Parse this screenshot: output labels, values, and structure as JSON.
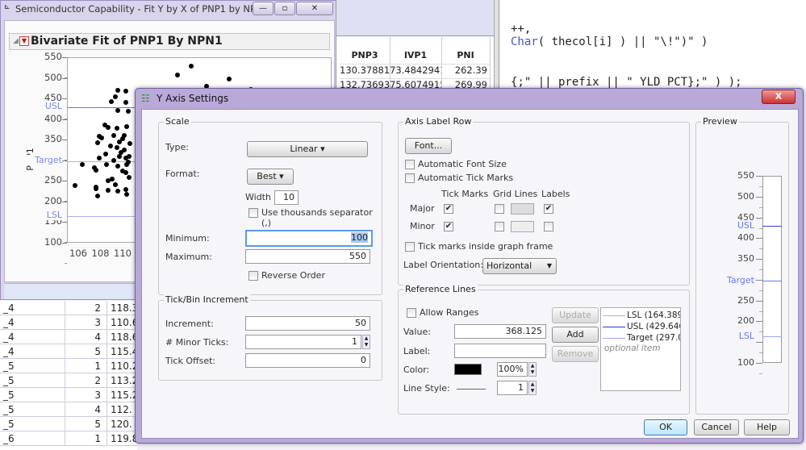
{
  "bg_window": {
    "title": "Semiconductor Capability - Fit Y by X of PNP1 by NP...",
    "outline_title": "Bivariate Fit of PNP1 By NPN1",
    "y_label": "PNP1",
    "y_ticks": [
      "550",
      "500",
      "450",
      "400",
      "350",
      "300",
      "250",
      "200",
      "150",
      "100"
    ],
    "x_ticks": [
      "106",
      "108",
      "110"
    ],
    "ref_lines": [
      {
        "label": "USL",
        "value": 429.646
      },
      {
        "label": "Target",
        "value": 297
      },
      {
        "label": "LSL",
        "value": 164.389
      }
    ],
    "points": [
      [
        116.1,
        529
      ],
      [
        114.9,
        507
      ],
      [
        119.5,
        497
      ],
      [
        117.5,
        480
      ],
      [
        121.5,
        471
      ],
      [
        109.5,
        470
      ],
      [
        110.2,
        468
      ],
      [
        112.8,
        470
      ],
      [
        117,
        470
      ],
      [
        114.5,
        455
      ],
      [
        109.3,
        455
      ],
      [
        108.9,
        443
      ],
      [
        110.2,
        440
      ],
      [
        113,
        435
      ],
      [
        109.5,
        420
      ],
      [
        110.4,
        418
      ],
      [
        108.3,
        385
      ],
      [
        108.6,
        380
      ],
      [
        109.4,
        378
      ],
      [
        110.3,
        382
      ],
      [
        107.8,
        358
      ],
      [
        108,
        355
      ],
      [
        109.1,
        360
      ],
      [
        109.6,
        345
      ],
      [
        109.9,
        352
      ],
      [
        107.7,
        342
      ],
      [
        108.8,
        335
      ],
      [
        109.4,
        330
      ],
      [
        109.8,
        320
      ],
      [
        110.1,
        325
      ],
      [
        108.4,
        316
      ],
      [
        107.8,
        305
      ],
      [
        109.1,
        300
      ],
      [
        109.6,
        310
      ],
      [
        110.2,
        305
      ],
      [
        106.3,
        290
      ],
      [
        107.4,
        282
      ],
      [
        107.5,
        277
      ],
      [
        108.5,
        290
      ],
      [
        109.5,
        285
      ],
      [
        109.9,
        275
      ],
      [
        110.2,
        270
      ],
      [
        108.6,
        250
      ],
      [
        109,
        255
      ],
      [
        107.5,
        232
      ],
      [
        107.5,
        235
      ],
      [
        108.6,
        228
      ],
      [
        109.3,
        240
      ],
      [
        109.5,
        225
      ],
      [
        110.2,
        230
      ],
      [
        105.6,
        238
      ],
      [
        107.7,
        213
      ],
      [
        110.3,
        218
      ],
      [
        110.5,
        258
      ],
      [
        110.4,
        295
      ],
      [
        110.6,
        340
      ],
      [
        110.1,
        360
      ],
      [
        110.3,
        290
      ],
      [
        110.5,
        310
      ]
    ]
  },
  "data_table": {
    "columns": [
      "PNP3",
      "IVP1",
      "PNI"
    ],
    "rows": [
      [
        "130.37881",
        "73.4842941",
        "262.39"
      ],
      [
        "132.736938",
        "75.6074915",
        "269.99"
      ]
    ]
  },
  "script": {
    "lines": [
      "++,",
      "Char( thecol[i] ) || \"\\!\")\" )",
      "{;\" || prefix || \" YLD PCT};\" ) );"
    ]
  },
  "left_table": {
    "rows": [
      [
        "_4",
        "2",
        "118.3"
      ],
      [
        "_4",
        "3",
        "110.6"
      ],
      [
        "_4",
        "4",
        "118.6"
      ],
      [
        "_4",
        "5",
        "115.4"
      ],
      [
        "_5",
        "1",
        "110.2"
      ],
      [
        "_5",
        "2",
        "113.2"
      ],
      [
        "_5",
        "3",
        "115.2"
      ],
      [
        "_5",
        "4",
        "112."
      ],
      [
        "_5",
        "5",
        "120."
      ],
      [
        "_6",
        "1",
        "119.8"
      ]
    ]
  },
  "dialog": {
    "title": "Y Axis Settings",
    "close": "X",
    "scale": {
      "legend": "Scale",
      "type_label": "Type:",
      "type_value": "Linear ▾",
      "format_label": "Format:",
      "format_value": "Best ▾",
      "width_label": "Width",
      "width_value": "10",
      "thousands": "Use thousands separator (,)",
      "min_label": "Minimum:",
      "min_value": "100",
      "max_label": "Maximum:",
      "max_value": "550",
      "reverse": "Reverse Order"
    },
    "tick": {
      "legend": "Tick/Bin Increment",
      "inc_label": "Increment:",
      "inc_value": "50",
      "minor_label": "# Minor Ticks:",
      "minor_value": "1",
      "offset_label": "Tick Offset:",
      "offset_value": "0"
    },
    "axis_label_row": {
      "legend": "Axis Label Row",
      "font_btn": "Font...",
      "auto_font": "Automatic Font Size",
      "auto_tick": "Automatic Tick Marks",
      "col_tick": "Tick Marks",
      "col_grid": "Grid Lines",
      "col_labels": "Labels",
      "major": "Major",
      "minor": "Minor",
      "inside": "Tick marks inside graph frame",
      "orient_label": "Label Orientation:",
      "orient_value": "Horizontal"
    },
    "ref": {
      "legend": "Reference Lines",
      "allow": "Allow Ranges",
      "value_label": "Value:",
      "value": "368.125",
      "label_label": "Label:",
      "label_value": "",
      "color_label": "Color:",
      "color": "#000000",
      "pct": "100%",
      "style_label": "Line Style:",
      "width": "1",
      "update": "Update",
      "add": "Add",
      "remove": "Remove",
      "items": [
        {
          "text": "LSL (164.389",
          "color": "#a8b0f0"
        },
        {
          "text": "USL (429.646",
          "color": "#2233dd"
        },
        {
          "text": "Target (297.0",
          "color": "#a8a0f0"
        }
      ],
      "optional": "optional item"
    },
    "preview": {
      "legend": "Preview",
      "ticks": [
        "550",
        "500",
        "450",
        "400",
        "350",
        "300",
        "250",
        "200",
        "150",
        "100"
      ],
      "usl": "USL",
      "target": "Target",
      "lsl": "LSL"
    },
    "ok": "OK",
    "cancel": "Cancel",
    "help": "Help"
  }
}
